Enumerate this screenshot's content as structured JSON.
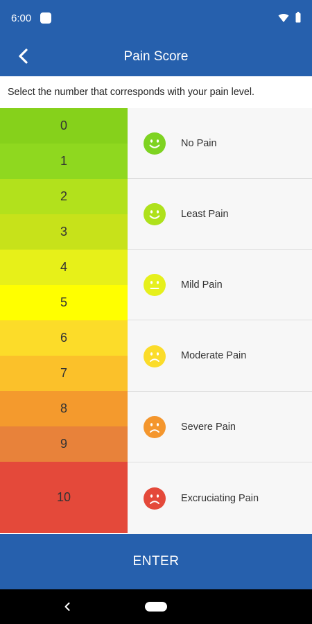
{
  "status_bar": {
    "time": "6:00",
    "icons": [
      "notification-icon",
      "wifi-icon",
      "battery-icon"
    ]
  },
  "app_bar": {
    "title": "Pain Score",
    "back_icon": "back-arrow-icon"
  },
  "instruction": "Select the number that corresponds with your pain level.",
  "scale": {
    "cells": [
      {
        "value": "0",
        "color": "#86d11b"
      },
      {
        "value": "1",
        "color": "#8fd81f"
      },
      {
        "value": "2",
        "color": "#b2e11c"
      },
      {
        "value": "3",
        "color": "#c7e21a"
      },
      {
        "value": "4",
        "color": "#e7f019"
      },
      {
        "value": "5",
        "color": "#ffff00"
      },
      {
        "value": "6",
        "color": "#fcdc29"
      },
      {
        "value": "7",
        "color": "#fbc12a"
      },
      {
        "value": "8",
        "color": "#f49a2d"
      },
      {
        "value": "9",
        "color": "#e8823a"
      },
      {
        "value": "10",
        "color": "#e4493a"
      }
    ]
  },
  "levels": [
    {
      "label": "No Pain",
      "face": "smile-face-icon",
      "color": "#7ed321"
    },
    {
      "label": "Least Pain",
      "face": "smile-face-icon",
      "color": "#aee11b"
    },
    {
      "label": "Mild Pain",
      "face": "neutral-face-icon",
      "color": "#e6f01c"
    },
    {
      "label": "Moderate Pain",
      "face": "frown-face-icon",
      "color": "#fbdc2a"
    },
    {
      "label": "Severe Pain",
      "face": "frown-face-icon",
      "color": "#f4962d"
    },
    {
      "label": "Excruciating Pain",
      "face": "frown-face-icon",
      "color": "#e4493a"
    }
  ],
  "enter_button": {
    "label": "ENTER"
  },
  "colors": {
    "primary": "#2660ad",
    "background": "#f7f7f7"
  }
}
